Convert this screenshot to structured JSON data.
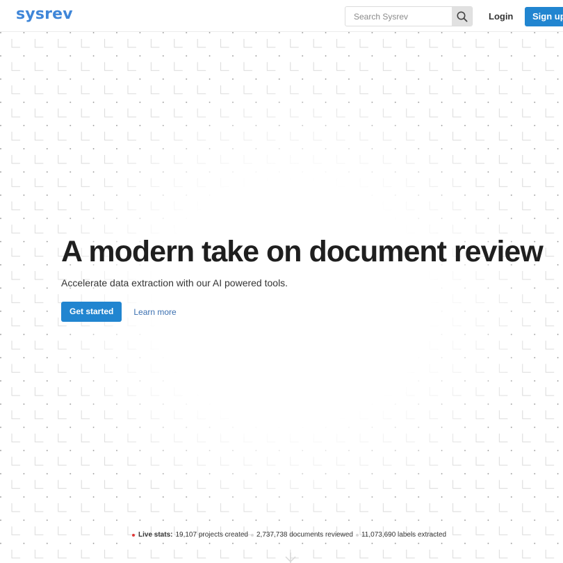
{
  "navbar": {
    "logo": "sysrev",
    "search_placeholder": "Search Sysrev",
    "login_label": "Login",
    "signup_label": "Sign up",
    "search_icon": "search-icon"
  },
  "hero": {
    "title": "A modern take on document review",
    "subtitle": "Accelerate data extraction with our AI powered tools.",
    "get_started_label": "Get started",
    "learn_more_label": "Learn more"
  },
  "stats": {
    "live_label": "Live stats:",
    "projects": "19,107 projects created",
    "documents": "2,737,738 documents reviewed",
    "labels": "11,073,690 labels extracted"
  },
  "colors": {
    "brand": "#3f86d8",
    "primary_button": "#2185d0",
    "live_dot": "#e03a3a"
  }
}
